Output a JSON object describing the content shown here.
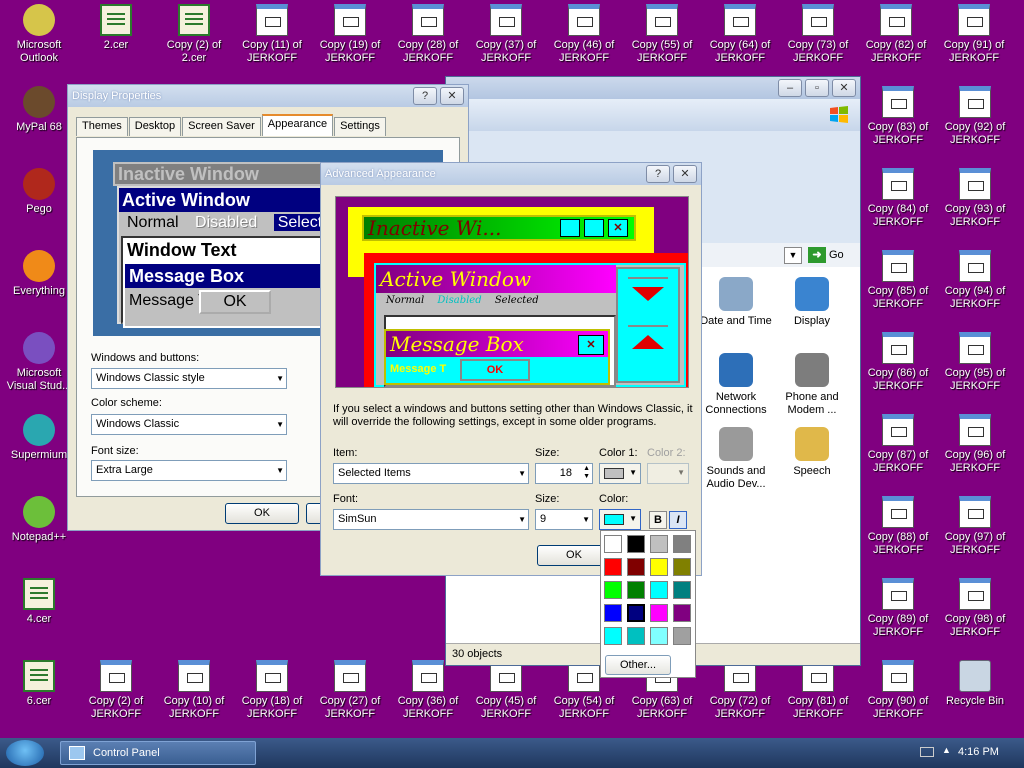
{
  "desktop": {
    "icons_left": [
      {
        "label": "Microsoft Outlook",
        "kind": "generic",
        "color": "#d6c54a"
      },
      {
        "label": "MyPal 68",
        "kind": "generic",
        "color": "#6b4a2c"
      },
      {
        "label": "Pego",
        "kind": "generic",
        "color": "#b0281c"
      },
      {
        "label": "Everything",
        "kind": "generic",
        "color": "#f08a18"
      },
      {
        "label": "Microsoft Visual Stud...",
        "kind": "generic",
        "color": "#7a4fc0"
      },
      {
        "label": "Supermium",
        "kind": "generic",
        "color": "#2aa7b0"
      },
      {
        "label": "Notepad++",
        "kind": "generic",
        "color": "#6cbf3a"
      },
      {
        "label": "4.cer",
        "kind": "cert"
      },
      {
        "label": "6.cer",
        "kind": "cert"
      }
    ],
    "icons_top": [
      {
        "label": "2.cer",
        "kind": "cert"
      },
      {
        "label": "Copy (2) of 2.cer",
        "kind": "cert"
      },
      {
        "label": "Copy (11) of JERKOFF",
        "kind": "doc"
      },
      {
        "label": "Copy (19) of JERKOFF",
        "kind": "doc"
      },
      {
        "label": "Copy (28) of JERKOFF",
        "kind": "doc"
      },
      {
        "label": "Copy (37) of JERKOFF",
        "kind": "doc"
      },
      {
        "label": "Copy (46) of JERKOFF",
        "kind": "doc"
      },
      {
        "label": "Copy (55) of JERKOFF",
        "kind": "doc"
      },
      {
        "label": "Copy (64) of JERKOFF",
        "kind": "doc"
      },
      {
        "label": "Copy (73) of JERKOFF",
        "kind": "doc"
      },
      {
        "label": "Copy (82) of JERKOFF",
        "kind": "doc"
      },
      {
        "label": "Copy (91) of JERKOFF",
        "kind": "doc"
      }
    ],
    "icons_right_col1": [
      {
        "label": "Copy (83) of JERKOFF"
      },
      {
        "label": "Copy (84) of JERKOFF"
      },
      {
        "label": "Copy (85) of JERKOFF"
      },
      {
        "label": "Copy (86) of JERKOFF"
      },
      {
        "label": "Copy (87) of JERKOFF"
      },
      {
        "label": "Copy (88) of JERKOFF"
      },
      {
        "label": "Copy (89) of JERKOFF"
      },
      {
        "label": "Copy (90) of JERKOFF"
      }
    ],
    "icons_right_col2": [
      {
        "label": "Copy (92) of JERKOFF",
        "kind": "doc"
      },
      {
        "label": "Copy (93) of JERKOFF",
        "kind": "doc"
      },
      {
        "label": "Copy (94) of JERKOFF",
        "kind": "doc"
      },
      {
        "label": "Copy (95) of JERKOFF",
        "kind": "doc"
      },
      {
        "label": "Copy (96) of JERKOFF",
        "kind": "doc"
      },
      {
        "label": "Copy (97) of JERKOFF",
        "kind": "doc"
      },
      {
        "label": "Copy (98) of JERKOFF",
        "kind": "doc"
      },
      {
        "label": "Recycle Bin",
        "kind": "recycle"
      }
    ],
    "icons_bottom": [
      {
        "label": "Copy (2) of JERKOFF"
      },
      {
        "label": "Copy (10) of JERKOFF"
      },
      {
        "label": "Copy (18) of JERKOFF"
      },
      {
        "label": "Copy (27) of JERKOFF"
      },
      {
        "label": "Copy (36) of JERKOFF"
      },
      {
        "label": "Copy (45) of JERKOFF"
      },
      {
        "label": "Copy (54) of JERKOFF"
      },
      {
        "label": "Copy (63) of JERKOFF"
      },
      {
        "label": "Copy (72) of JERKOFF"
      },
      {
        "label": "Copy (81) of JERKOFF"
      }
    ]
  },
  "control_panel": {
    "address_go": "Go",
    "status": "30 objects",
    "items": [
      {
        "label": "Date and Time",
        "color": "#8aa8c8"
      },
      {
        "label": "Display",
        "color": "#3a84d0"
      },
      {
        "label": "Network Connections",
        "color": "#2d6fb8"
      },
      {
        "label": "Phone and Modem ...",
        "color": "#7d7d7d"
      },
      {
        "label": "Sounds and Audio Dev...",
        "color": "#9a9a9a"
      },
      {
        "label": "Speech",
        "color": "#e0b84a"
      }
    ]
  },
  "display_properties": {
    "title": "Display Properties",
    "help": "?",
    "close": "✕",
    "tabs": [
      "Themes",
      "Desktop",
      "Screen Saver",
      "Appearance",
      "Settings"
    ],
    "selected_tab": "Appearance",
    "preview": {
      "inactive": "Inactive Window",
      "active": "Active Window",
      "normal": "Normal",
      "disabled": "Disabled",
      "selected": "Selected",
      "window_text": "Window Text",
      "message_box": "Message Box",
      "message_text": "Message T",
      "ok": "OK"
    },
    "windows_buttons_label": "Windows and buttons:",
    "windows_buttons_value": "Windows Classic style",
    "color_scheme_label": "Color scheme:",
    "color_scheme_value": "Windows Classic",
    "font_size_label": "Font size:",
    "font_size_value": "Extra Large",
    "ok": "OK"
  },
  "advanced": {
    "title": "Advanced Appearance",
    "help": "?",
    "close": "✕",
    "preview": {
      "inactive": "Inactive Wi...",
      "active": "Active Window",
      "normal": "Normal",
      "disabled": "Disabled",
      "selected": "Selected",
      "message_box": "Message Box",
      "message_text": "Message T",
      "ok": "OK"
    },
    "note": "If you select a windows and buttons setting other than Windows Classic, it will override the following settings, except in some older programs.",
    "item_label": "Item:",
    "item_value": "Selected Items",
    "size_label": "Size:",
    "size_value": "18",
    "color1_label": "Color 1:",
    "color2_label": "Color 2:",
    "font_label": "Font:",
    "font_value": "SimSun",
    "font_size_label": "Size:",
    "font_size_value": "9",
    "font_color_label": "Color:",
    "bold": "B",
    "italic": "I",
    "ok": "OK",
    "color1": "#c0c0c0",
    "font_color": "#00ffff"
  },
  "palette": {
    "colors": [
      "#ffffff",
      "#000000",
      "#c0c0c0",
      "#808080",
      "#ff0000",
      "#800000",
      "#ffff00",
      "#808000",
      "#00ff00",
      "#008000",
      "#00ffff",
      "#008080",
      "#0000ff",
      "#000080",
      "#ff00ff",
      "#800080",
      "#00ffff",
      "#00c0c0",
      "#80ffff",
      "#a0a0a0"
    ],
    "selected_index": 13,
    "other": "Other..."
  },
  "taskbar": {
    "task": "Control Panel",
    "time": "4:16 PM"
  }
}
